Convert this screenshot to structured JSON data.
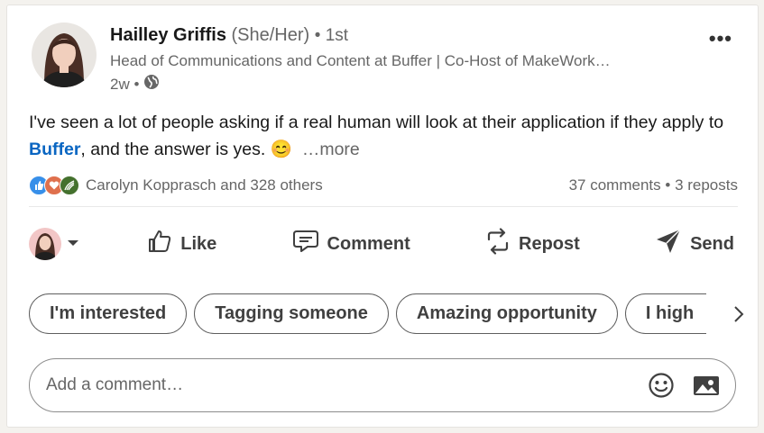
{
  "post": {
    "author": {
      "name": "Hailley Griffis",
      "pronouns": "(She/Her)",
      "degree": "• 1st",
      "headline": "Head of Communications and Content at Buffer | Co-Host of MakeWork…",
      "time": "2w •",
      "visibility_icon": "globe-icon"
    },
    "menu_label": "•••",
    "text": {
      "before_link": "I've seen a lot of people asking if a real human will look at their application if they apply to ",
      "link": "Buffer",
      "after_link": ", and the answer is yes. ",
      "emoji": "😊",
      "see_more": "…more"
    },
    "social": {
      "reaction_icons": [
        "like-reaction-icon",
        "love-reaction-icon",
        "support-reaction-icon"
      ],
      "reactors": "Carolyn Kopprasch and 328 others",
      "comments": "37 comments",
      "separator": "•",
      "reposts": "3 reposts"
    }
  },
  "actions": {
    "like": "Like",
    "comment": "Comment",
    "repost": "Repost",
    "send": "Send"
  },
  "suggestions": [
    "I'm interested",
    "Tagging someone",
    "Amazing opportunity",
    "I high"
  ],
  "comment_box": {
    "placeholder": "Add a comment…"
  },
  "colors": {
    "link": "#0a66c2",
    "muted_text": "#666666",
    "page_bg": "#f4f2ee",
    "like_reaction": "#378fe9",
    "love_reaction": "#df704d",
    "support_reaction": "#44712e"
  }
}
